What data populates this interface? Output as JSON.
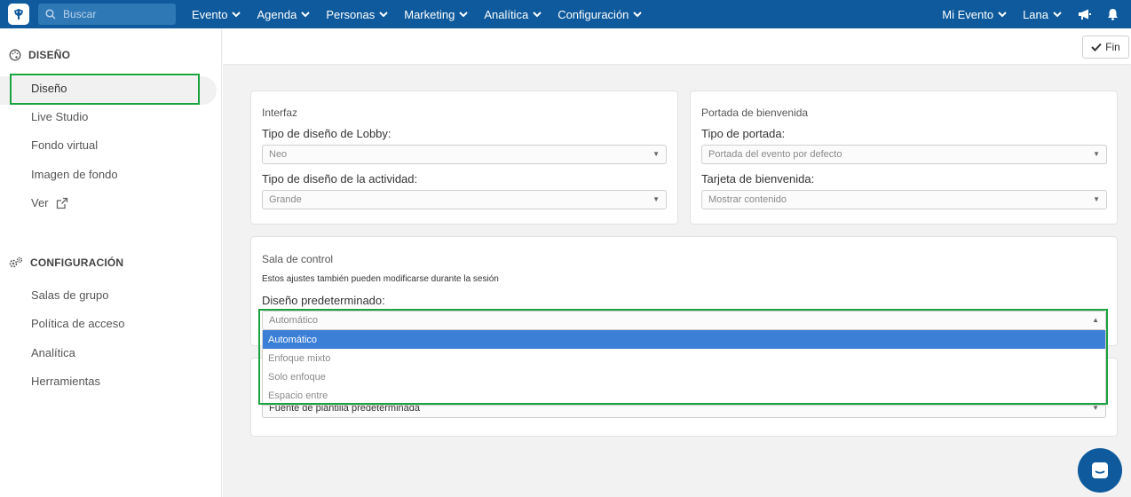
{
  "topbar": {
    "search_placeholder": "Buscar",
    "menu": [
      "Evento",
      "Agenda",
      "Personas",
      "Marketing",
      "Analítica",
      "Configuración"
    ],
    "right": {
      "event": "Mi Evento",
      "language": "Lana"
    },
    "colors": {
      "bar": "#0e5a9c"
    }
  },
  "sidebar": {
    "design_section": "DISEÑO",
    "design_items": [
      "Diseño",
      "Live Studio",
      "Fondo virtual",
      "Imagen de fondo",
      "Ver"
    ],
    "config_section": "CONFIGURACIÓN",
    "config_items": [
      "Salas de grupo",
      "Política de acceso",
      "Analítica",
      "Herramientas"
    ],
    "active_item": "Diseño"
  },
  "header": {
    "done_label": "Fin"
  },
  "interfaz": {
    "title": "Interfaz",
    "lobby_label": "Tipo de diseño de Lobby:",
    "lobby_value": "Neo",
    "activity_label": "Tipo de diseño de la actividad:",
    "activity_value": "Grande"
  },
  "portada": {
    "title": "Portada de bienvenida",
    "type_label": "Tipo de portada:",
    "type_value": "Portada del evento por defecto",
    "card_label": "Tarjeta de bienvenida:",
    "card_value": "Mostrar contenido"
  },
  "sala": {
    "title": "Sala de control",
    "note": "Estos ajustes también pueden modificarse durante la sesión",
    "layout_label": "Diseño predeterminado:",
    "layout_value": "Automático",
    "options": [
      "Automático",
      "Enfoque mixto",
      "Solo enfoque",
      "Espacio entre"
    ],
    "selected_option": "Automático"
  },
  "font_card": {
    "value": "Fuente de plantilla predeterminada"
  },
  "colors": {
    "highlight": "#1aa33f",
    "selected_option": "#3b7fd6"
  }
}
